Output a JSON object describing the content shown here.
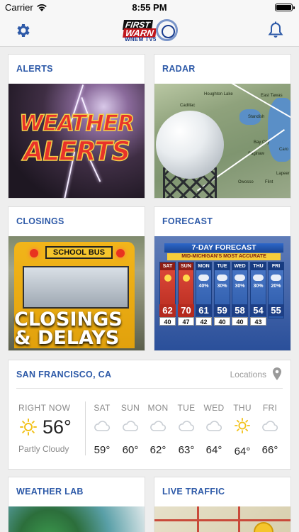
{
  "status_bar": {
    "carrier": "Carrier",
    "time": "8:55 PM"
  },
  "nav": {
    "logo": {
      "first": "FIRST",
      "warn": "WARN",
      "station": "WNEM TV5"
    },
    "left_icon": "gear-icon",
    "right_icon": "bell-icon",
    "icon_color": "#2e5aa8"
  },
  "tiles": {
    "alerts": {
      "title": "ALERTS",
      "image_text_1": "WEATHER",
      "image_text_2": "ALERTS"
    },
    "radar": {
      "title": "RADAR",
      "towns": [
        "Cadillac",
        "Houghton Lake",
        "East Tawas",
        "Standish",
        "Bay City",
        "Saginaw",
        "Caro",
        "Owosso",
        "Flint",
        "Lapeer"
      ]
    },
    "closings": {
      "title": "CLOSINGS",
      "bus_sign": "SCHOOL BUS",
      "image_text_1": "CLOSINGS",
      "image_text_2": "& DELAYS"
    },
    "forecast": {
      "title": "FORECAST",
      "image_title": "7-DAY FORECAST",
      "image_subtitle": "MID-MICHIGAN'S MOST ACCURATE",
      "days": [
        {
          "day": "SAT",
          "hi": "62",
          "lo": "40",
          "pct": "",
          "red": true
        },
        {
          "day": "SUN",
          "hi": "70",
          "lo": "47",
          "pct": "",
          "red": true
        },
        {
          "day": "MON",
          "hi": "61",
          "lo": "42",
          "pct": "40%",
          "red": false
        },
        {
          "day": "TUE",
          "hi": "59",
          "lo": "40",
          "pct": "30%",
          "red": false
        },
        {
          "day": "WED",
          "hi": "58",
          "lo": "40",
          "pct": "30%",
          "red": false
        },
        {
          "day": "THU",
          "hi": "54",
          "lo": "43",
          "pct": "30%",
          "red": false
        },
        {
          "day": "FRI",
          "hi": "55",
          "lo": "",
          "pct": "20%",
          "red": false
        }
      ]
    },
    "weather_lab": {
      "title": "WEATHER LAB"
    },
    "live_traffic": {
      "title": "LIVE TRAFFIC"
    }
  },
  "weather": {
    "city": "SAN FRANCISCO, CA",
    "locations_label": "Locations",
    "now": {
      "label": "RIGHT NOW",
      "temp": "56°",
      "condition": "Partly Cloudy",
      "icon": "sun-icon"
    },
    "days": [
      {
        "name": "SAT",
        "temp": "59°",
        "icon": "cloud-icon"
      },
      {
        "name": "SUN",
        "temp": "60°",
        "icon": "cloud-icon"
      },
      {
        "name": "MON",
        "temp": "62°",
        "icon": "cloud-icon"
      },
      {
        "name": "TUE",
        "temp": "63°",
        "icon": "cloud-icon"
      },
      {
        "name": "WED",
        "temp": "64°",
        "icon": "cloud-icon"
      },
      {
        "name": "THU",
        "temp": "64°",
        "icon": "sun-icon"
      },
      {
        "name": "FRI",
        "temp": "66°",
        "icon": "cloud-icon"
      }
    ],
    "accent_color": "#2e5aa8",
    "sun_color": "#f2c21a",
    "cloud_color": "#c9ced4"
  }
}
